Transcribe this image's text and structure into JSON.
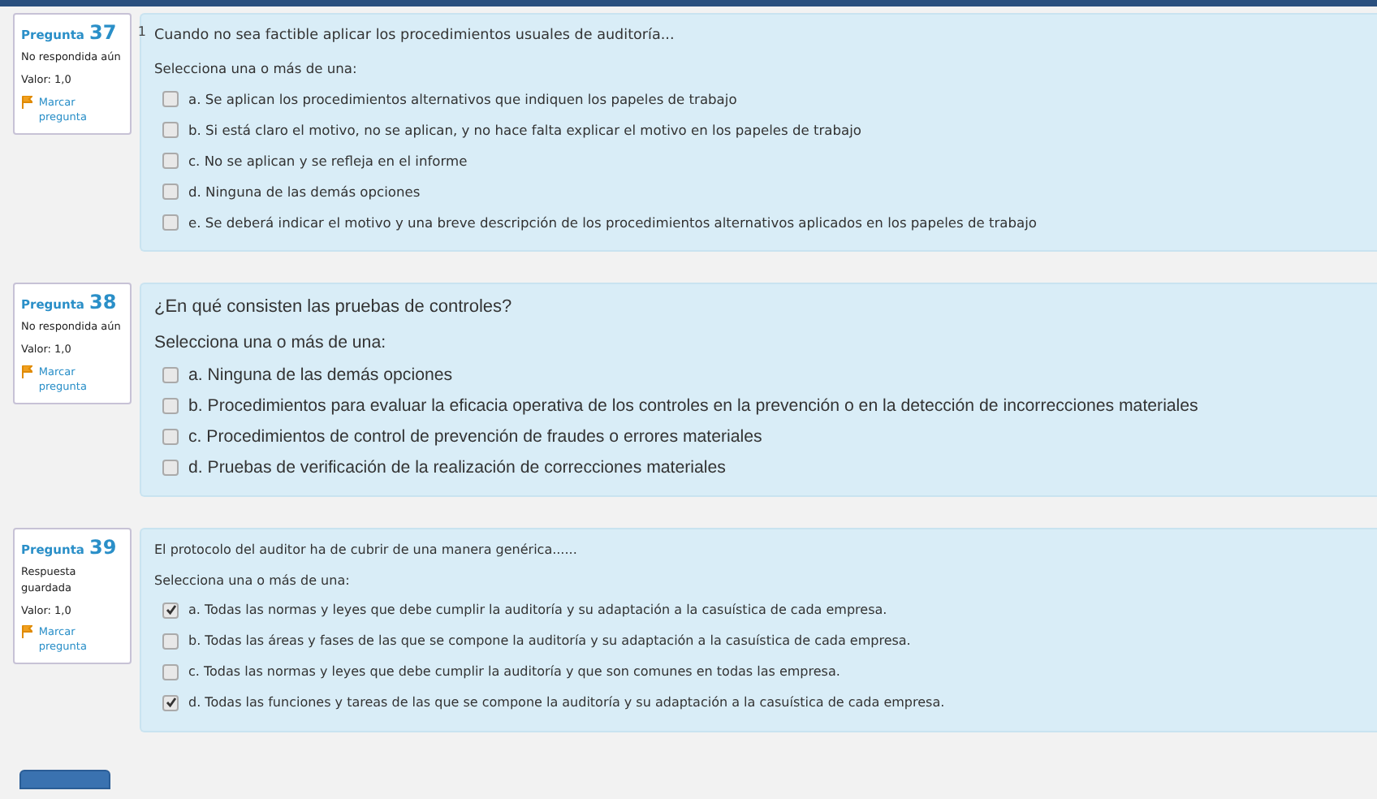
{
  "questions": [
    {
      "label": "Pregunta",
      "number": "37",
      "status": "No respondida aún",
      "value": "Valor: 1,0",
      "flag": "Marcar pregunta",
      "marker": "1",
      "kind": "verdana",
      "prompt": "Cuando no sea factible aplicar los procedimientos usuales de auditoría...",
      "instruction": "Selecciona una o más de una:",
      "options": [
        {
          "text": "a. Se aplican los procedimientos alternativos que indiquen los papeles de trabajo",
          "checked": false
        },
        {
          "text": "b. Si está claro el motivo, no se aplican, y no hace falta explicar el motivo en los papeles de trabajo",
          "checked": false
        },
        {
          "text": "c. No se aplican y se refleja en el informe",
          "checked": false
        },
        {
          "text": "d. Ninguna de las demás opciones",
          "checked": false
        },
        {
          "text": "e. Se deberá indicar el motivo y una breve descripción de los procedimientos alternativos aplicados en los papeles de trabajo",
          "checked": false
        }
      ]
    },
    {
      "label": "Pregunta",
      "number": "38",
      "status": "No respondida aún",
      "value": "Valor: 1,0",
      "flag": "Marcar pregunta",
      "kind": "arial",
      "prompt": "¿En qué consisten las pruebas de controles?",
      "instruction": "Selecciona una o más de una:",
      "options": [
        {
          "text": "a. Ninguna de las demás opciones",
          "checked": false
        },
        {
          "text": "b. Procedimientos para evaluar la eficacia operativa de los controles en la prevención o en la detección de incorrecciones materiales",
          "checked": false
        },
        {
          "text": "c. Procedimientos de control de prevención de fraudes o errores materiales",
          "checked": false
        },
        {
          "text": "d. Pruebas de verificación de la realización de correcciones materiales",
          "checked": false
        }
      ]
    },
    {
      "label": "Pregunta",
      "number": "39",
      "status": "Respuesta guardada",
      "value": "Valor: 1,0",
      "flag": "Marcar pregunta",
      "kind": "verdanasmall",
      "prompt": "El protocolo del auditor ha de cubrir de una manera genérica......",
      "instruction": "Selecciona una o más de una:",
      "options": [
        {
          "text": "a. Todas las normas y leyes que debe cumplir la auditoría y su adaptación a la casuística de cada empresa.",
          "checked": true
        },
        {
          "text": "b. Todas las áreas y fases de las que se compone la auditoría y su adaptación a la casuística de cada empresa.",
          "checked": false
        },
        {
          "text": "c. Todas las normas y leyes que debe cumplir la auditoría y que son comunes en todas las empresa.",
          "checked": false
        },
        {
          "text": "d. Todas las funciones y tareas de las que se compone la auditoría y su adaptación a la casuística de cada empresa.",
          "checked": true
        }
      ]
    }
  ]
}
